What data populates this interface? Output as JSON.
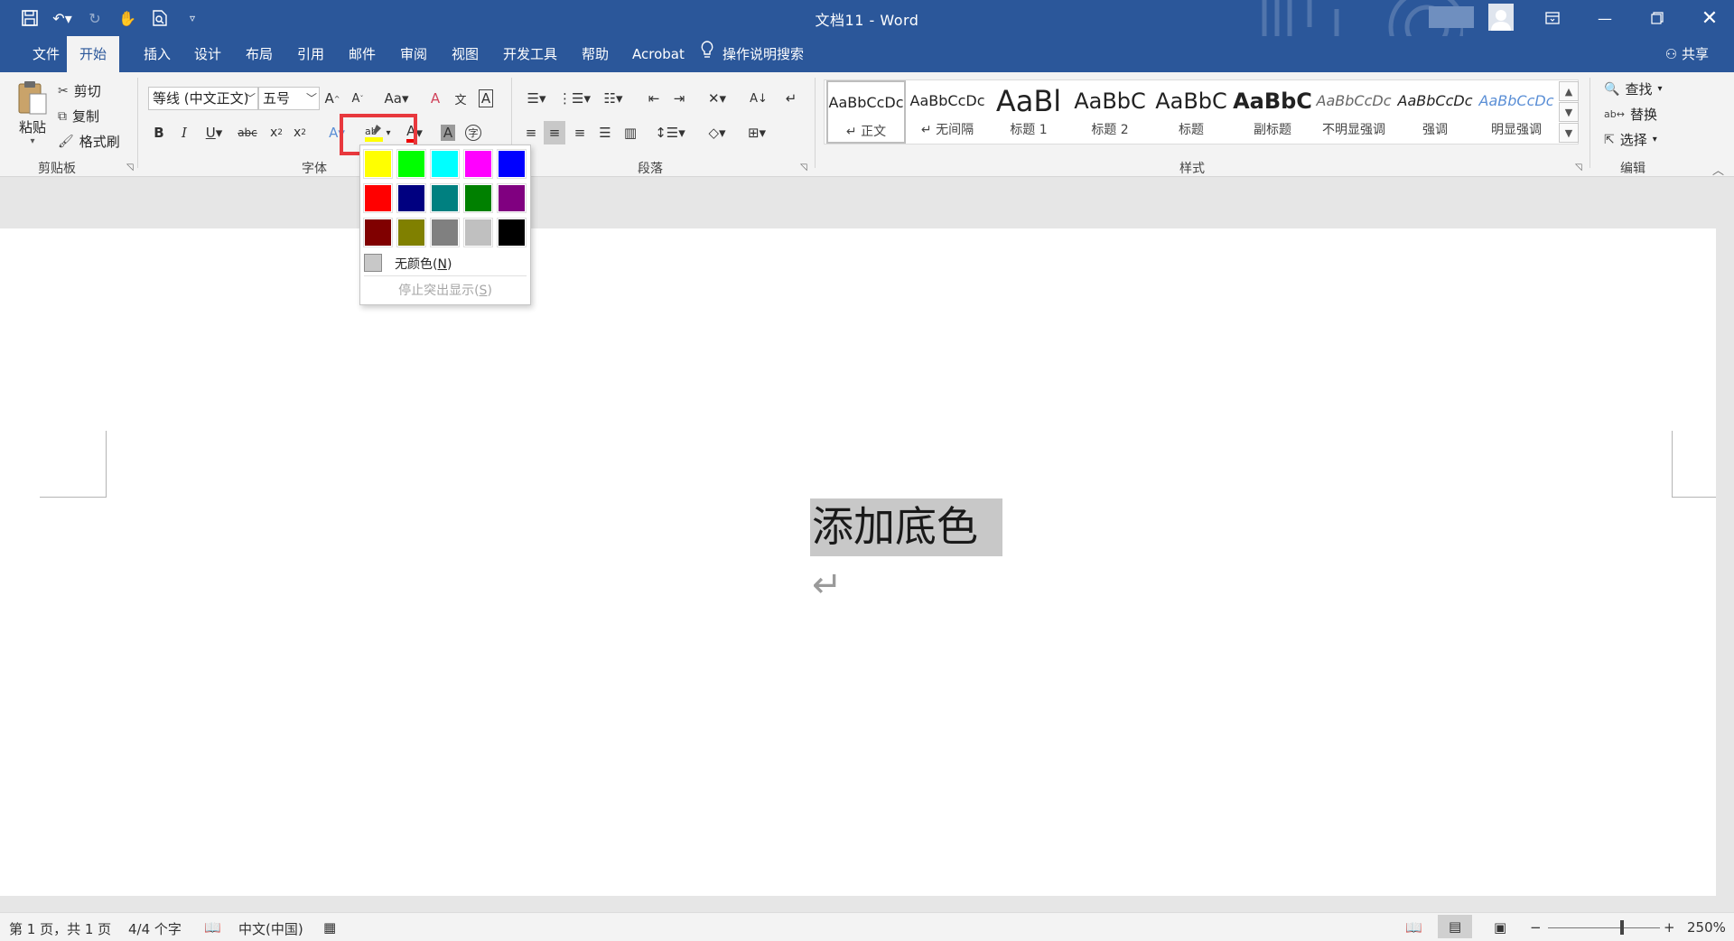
{
  "window": {
    "title": "文档11  -  Word",
    "controls": [
      "restore-ribbon",
      "minimize",
      "restore",
      "close"
    ]
  },
  "qat": [
    "save-icon",
    "undo-icon",
    "redo-icon",
    "touch-mode-icon",
    "print-preview-icon",
    "customize-icon"
  ],
  "tabs": [
    {
      "label": "文件"
    },
    {
      "label": "开始"
    },
    {
      "label": "插入"
    },
    {
      "label": "设计"
    },
    {
      "label": "布局"
    },
    {
      "label": "引用"
    },
    {
      "label": "邮件"
    },
    {
      "label": "审阅"
    },
    {
      "label": "视图"
    },
    {
      "label": "开发工具"
    },
    {
      "label": "帮助"
    },
    {
      "label": "Acrobat"
    }
  ],
  "tell_me": "操作说明搜索",
  "share": "共享",
  "clipboard": {
    "group": "剪贴板",
    "paste": "粘贴",
    "cut": "剪切",
    "copy": "复制",
    "format_painter": "格式刷"
  },
  "font": {
    "group": "字体",
    "name": "等线 (中文正文)",
    "size": "五号"
  },
  "paragraph": {
    "group": "段落"
  },
  "styles": {
    "group": "样式",
    "items": [
      {
        "preview": "AaBbCcDc",
        "label": "↵ 正文"
      },
      {
        "preview": "AaBbCcDc",
        "label": "↵ 无间隔"
      },
      {
        "preview": "AaBl",
        "label": "标题 1"
      },
      {
        "preview": "AaBbC",
        "label": "标题 2"
      },
      {
        "preview": "AaBbC",
        "label": "标题"
      },
      {
        "preview": "AaBbC",
        "label": "副标题"
      },
      {
        "preview": "AaBbCcDc",
        "label": "不明显强调"
      },
      {
        "preview": "AaBbCcDc",
        "label": "强调"
      },
      {
        "preview": "AaBbCcDc",
        "label": "明显强调"
      }
    ]
  },
  "editing": {
    "group": "编辑",
    "find": "查找",
    "replace": "替换",
    "select": "选择"
  },
  "highlight_dropdown": {
    "colors": [
      "#ffff00",
      "#00ff00",
      "#00ffff",
      "#ff00ff",
      "#0000ff",
      "#ff0000",
      "#000080",
      "#008080",
      "#008000",
      "#800080",
      "#800000",
      "#808000",
      "#808080",
      "#c0c0c0",
      "#000000"
    ],
    "no_color": "无颜色",
    "no_color_key": "N",
    "stop_highlight": "停止突出显示",
    "stop_highlight_key": "S"
  },
  "document": {
    "text": "添加底色",
    "pilcrow": "↵"
  },
  "status": {
    "page": "第 1 页，共 1 页",
    "words": "4/4 个字",
    "language": "中文(中国)",
    "zoom": "250%"
  }
}
